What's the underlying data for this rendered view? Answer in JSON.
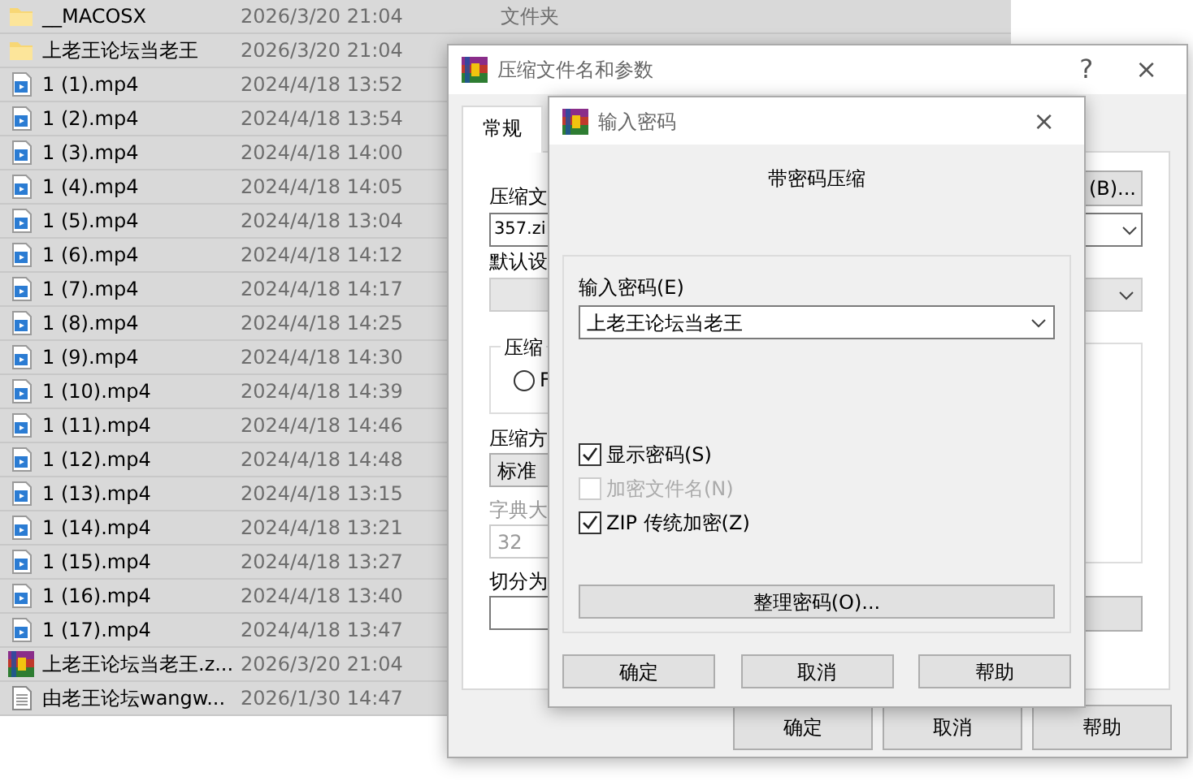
{
  "files": [
    {
      "kind": "folder",
      "name": "__MACOSX",
      "date": "2026/3/20 21:04",
      "type": "文件夹",
      "selected": true
    },
    {
      "kind": "folder",
      "name": "上老王论坛当老王",
      "date": "2026/3/20 21:04",
      "selected": true
    },
    {
      "kind": "video",
      "name": "1 (1).mp4",
      "date": "2024/4/18 13:52",
      "selected": true
    },
    {
      "kind": "video",
      "name": "1 (2).mp4",
      "date": "2024/4/18 13:54",
      "selected": true
    },
    {
      "kind": "video",
      "name": "1 (3).mp4",
      "date": "2024/4/18 14:00",
      "selected": true
    },
    {
      "kind": "video",
      "name": "1 (4).mp4",
      "date": "2024/4/18 14:05",
      "selected": true
    },
    {
      "kind": "video",
      "name": "1 (5).mp4",
      "date": "2024/4/18 13:04",
      "selected": true
    },
    {
      "kind": "video",
      "name": "1 (6).mp4",
      "date": "2024/4/18 14:12",
      "selected": true
    },
    {
      "kind": "video",
      "name": "1 (7).mp4",
      "date": "2024/4/18 14:17",
      "selected": true
    },
    {
      "kind": "video",
      "name": "1 (8).mp4",
      "date": "2024/4/18 14:25",
      "selected": true
    },
    {
      "kind": "video",
      "name": "1 (9).mp4",
      "date": "2024/4/18 14:30",
      "selected": true
    },
    {
      "kind": "video",
      "name": "1 (10).mp4",
      "date": "2024/4/18 14:39",
      "selected": true
    },
    {
      "kind": "video",
      "name": "1 (11).mp4",
      "date": "2024/4/18 14:46",
      "selected": true
    },
    {
      "kind": "video",
      "name": "1 (12).mp4",
      "date": "2024/4/18 14:48",
      "selected": true
    },
    {
      "kind": "video",
      "name": "1 (13).mp4",
      "date": "2024/4/18 13:15",
      "selected": true
    },
    {
      "kind": "video",
      "name": "1 (14).mp4",
      "date": "2024/4/18 13:21",
      "selected": true
    },
    {
      "kind": "video",
      "name": "1 (15).mp4",
      "date": "2024/4/18 13:27",
      "selected": true
    },
    {
      "kind": "video",
      "name": "1 (16).mp4",
      "date": "2024/4/18 13:40",
      "selected": true
    },
    {
      "kind": "video",
      "name": "1 (17).mp4",
      "date": "2024/4/18 13:47",
      "selected": true
    },
    {
      "kind": "archive",
      "name": "上老王论坛当老王.z...",
      "date": "2026/3/20 21:04",
      "selected": true
    },
    {
      "kind": "text",
      "name": "由老王论坛wangw...",
      "date": "2026/1/30 14:47",
      "selected": true
    }
  ],
  "archive_dialog": {
    "title": "压缩文件名和参数",
    "help": "?",
    "close": "×",
    "tabs": [
      {
        "label": "常规",
        "selected": true
      }
    ],
    "archive_name_label": "压缩文",
    "archive_name": "357.zi",
    "browse_button": "(B)...",
    "profile_label": "默认设",
    "format_group": "压缩",
    "format_option": {
      "label": "F",
      "selected": false
    },
    "method_label": "压缩方",
    "method": "标准",
    "dictionary_label": "字典大",
    "dictionary": "32",
    "split_label": "切分为",
    "buttons": [
      "确定",
      "取消",
      "帮助"
    ]
  },
  "password_dialog": {
    "title": "输入密码",
    "close": "×",
    "heading": "带密码压缩",
    "password_label": "输入密码(E)",
    "password": "上老王论坛当老王",
    "options": [
      {
        "label": "显示密码(S)",
        "checked": true,
        "disabled": false
      },
      {
        "label": "加密文件名(N)",
        "checked": false,
        "disabled": true
      },
      {
        "label": "ZIP 传统加密(Z)",
        "checked": true,
        "disabled": false
      }
    ],
    "organize_button": "整理密码(O)...",
    "buttons": [
      "确定",
      "取消",
      "帮助"
    ]
  }
}
